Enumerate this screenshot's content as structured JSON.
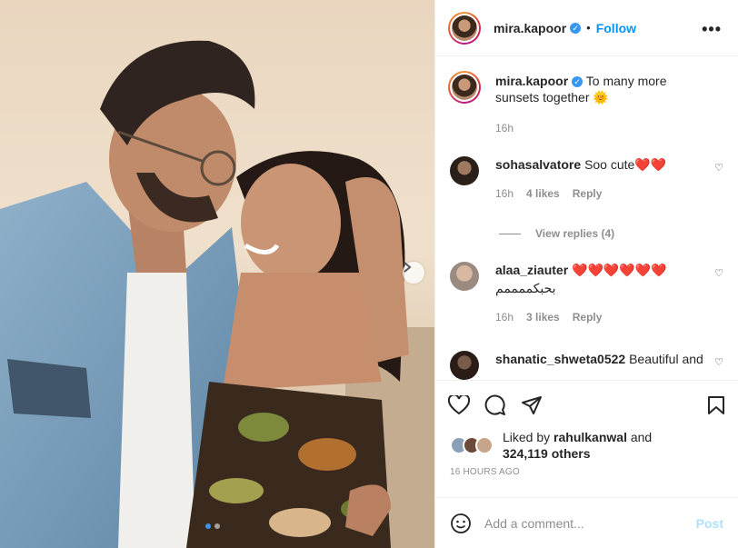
{
  "post": {
    "username": "mira.kapoor",
    "follow_label": "Follow",
    "more_label": "•••",
    "caption": "To many more sunsets together",
    "caption_emoji": "🌞",
    "caption_time": "16h"
  },
  "comments": [
    {
      "username": "sohasalvatore",
      "text": "Soo cute",
      "hearts": "❤️❤️",
      "time": "16h",
      "likes": "4 likes",
      "reply": "Reply"
    },
    {
      "username": "alaa_ziauter",
      "text": "بحبكممممم",
      "hearts": "❤️❤️❤️❤️❤️❤️",
      "time": "16h",
      "likes": "3 likes",
      "reply": "Reply"
    },
    {
      "username": "shanatic_shweta0522",
      "text": "Beautiful and"
    }
  ],
  "view_replies": "View replies (4)",
  "likes": {
    "prefix": "Liked by",
    "user": "rahulkanwal",
    "and": "and",
    "others": "324,119 others"
  },
  "timestamp": "16 HOURS AGO",
  "add_comment": {
    "placeholder": "Add a comment...",
    "post_label": "Post"
  },
  "colors": {
    "accent": "#0095f6",
    "verified": "#3897f0",
    "muted": "#8e8e8e",
    "heart": "#e0162b"
  },
  "carousel": {
    "slides": 2,
    "active": 1
  }
}
